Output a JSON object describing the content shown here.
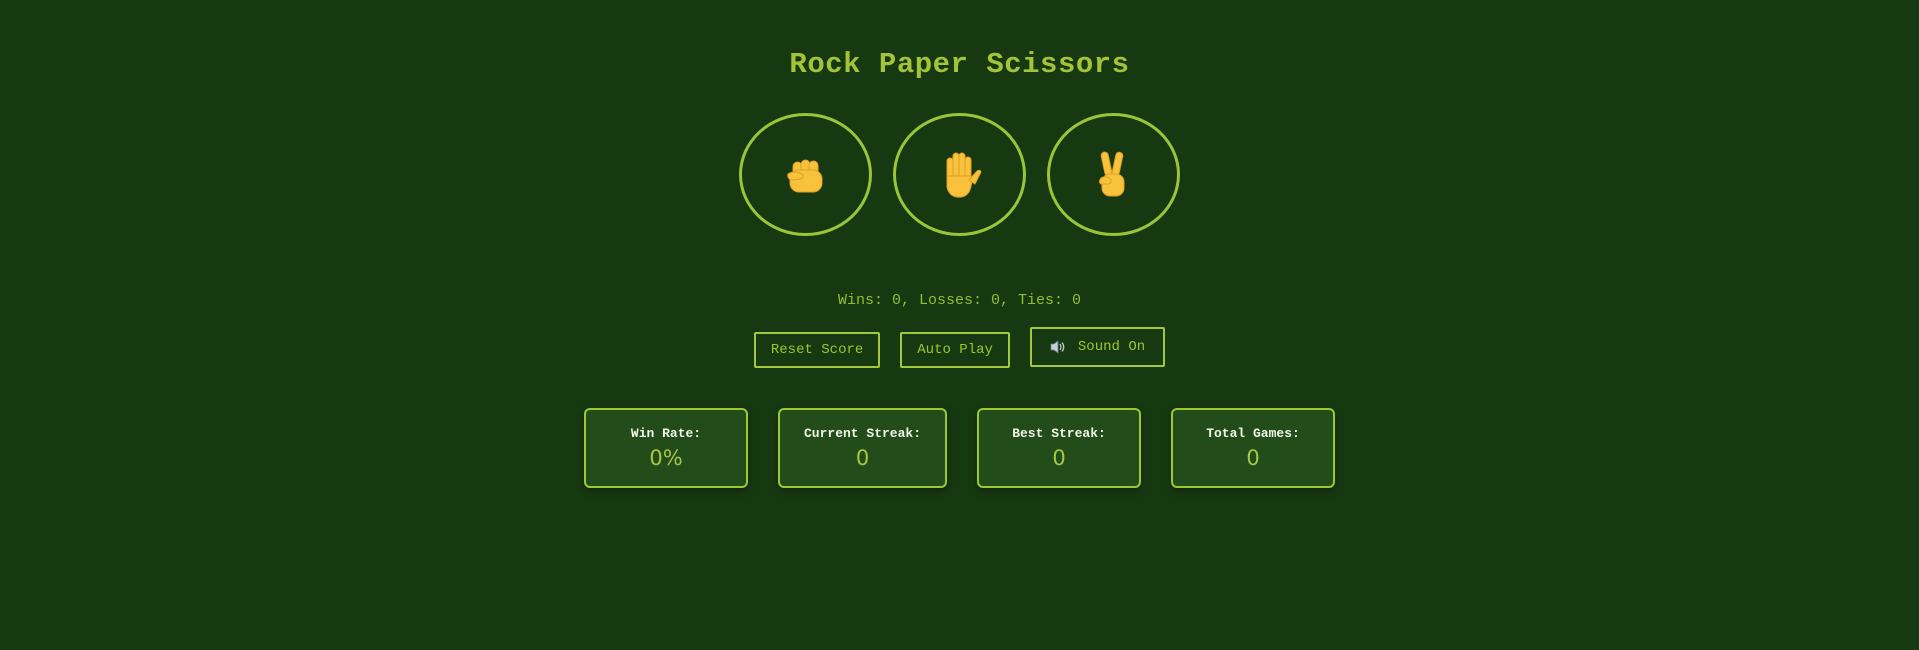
{
  "game": {
    "title": "Rock Paper Scissors",
    "choices": [
      {
        "name": "rock",
        "icon": "raised-fist-icon"
      },
      {
        "name": "paper",
        "icon": "raised-hand-icon"
      },
      {
        "name": "scissors",
        "icon": "victory-hand-icon"
      }
    ],
    "score_text": "Wins: 0, Losses: 0, Ties: 0"
  },
  "controls": {
    "reset_label": "Reset Score",
    "autoplay_label": "Auto Play",
    "sound_label": "Sound On",
    "sound_icon": "speaker-icon"
  },
  "stats": {
    "win_rate": {
      "label": "Win Rate:",
      "value": "0%"
    },
    "current_streak": {
      "label": "Current Streak:",
      "value": "0"
    },
    "best_streak": {
      "label": "Best Streak:",
      "value": "0"
    },
    "total_games": {
      "label": "Total Games:",
      "value": "0"
    }
  },
  "colors": {
    "background": "#173912",
    "accent": "#9dc630",
    "stat_card_bg": "#234c1b",
    "emoji_yellow": "#f9c23c"
  }
}
